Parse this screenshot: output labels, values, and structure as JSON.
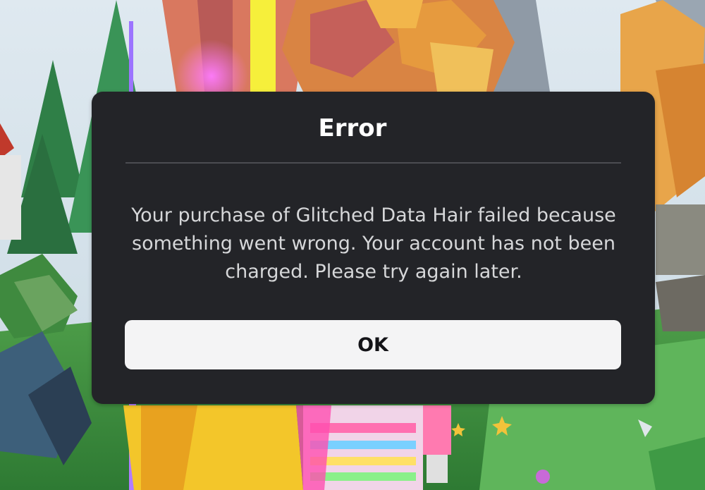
{
  "dialog": {
    "title": "Error",
    "message": "Your purchase of Glitched Data Hair failed because something went wrong. Your account has not been charged. Please try again later.",
    "ok_label": "OK"
  },
  "colors": {
    "dialog_background": "#232428",
    "divider": "#4b4c52",
    "title_text": "#ffffff",
    "body_text": "#d6d7d9",
    "button_background": "#f4f4f5",
    "button_text": "#141418"
  }
}
